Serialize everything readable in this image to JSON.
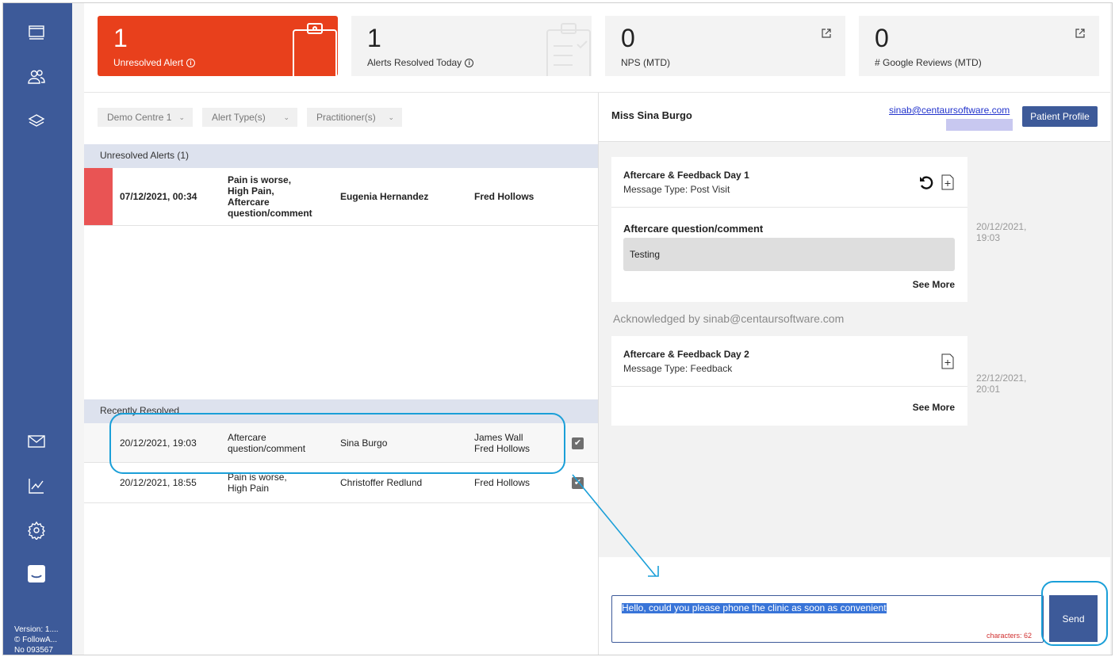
{
  "sidebar": {
    "nav_icons": [
      "dashboard-icon",
      "patients-icon",
      "layers-icon",
      "mail-icon",
      "chart-icon",
      "settings-icon",
      "inbox-icon"
    ],
    "version_lines": [
      "Version: 1....",
      "© FollowA...",
      "No 093567"
    ]
  },
  "stats": [
    {
      "value": "1",
      "label": "Unresolved Alert",
      "has_info": true,
      "color": "#e8401c"
    },
    {
      "value": "1",
      "label": "Alerts Resolved Today",
      "has_info": true
    },
    {
      "value": "0",
      "label": "NPS (MTD)",
      "has_link": true
    },
    {
      "value": "0",
      "label": "# Google Reviews (MTD)",
      "has_link": true
    }
  ],
  "filters": [
    {
      "label": "Demo Centre 1"
    },
    {
      "label": "Alert Type(s)"
    },
    {
      "label": "Practitioner(s)"
    }
  ],
  "unresolved": {
    "heading": "Unresolved Alerts (1)",
    "rows": [
      {
        "datetime": "07/12/2021, 00:34",
        "alert_lines": [
          "Pain is worse,",
          "High Pain,",
          "Aftercare",
          "question/comment"
        ],
        "patient": "Eugenia Hernandez",
        "practitioners": [
          "Fred Hollows"
        ]
      }
    ]
  },
  "resolved": {
    "heading": "Recently Resolved",
    "rows": [
      {
        "datetime": "20/12/2021, 19:03",
        "alert_lines": [
          "Aftercare",
          "question/comment"
        ],
        "patient": "Sina Burgo",
        "practitioners": [
          "James Wall",
          "Fred Hollows"
        ],
        "checked": true
      },
      {
        "datetime": "20/12/2021, 18:55",
        "alert_lines": [
          "Pain is worse,",
          "High Pain"
        ],
        "patient": "Christoffer Redlund",
        "practitioners": [
          "Fred Hollows"
        ],
        "checked": true
      }
    ]
  },
  "patient": {
    "name": "Miss Sina Burgo",
    "email": "sinab@centaursoftware.com",
    "profile_button": "Patient Profile"
  },
  "messages": [
    {
      "title": "Aftercare & Feedback Day 1",
      "type": "Message Type: Post Visit",
      "question": "Aftercare question/comment",
      "answer": "Testing",
      "see_more": "See More",
      "time_lines": [
        "20/12/2021,",
        "19:03"
      ]
    },
    {
      "title": "Aftercare & Feedback Day 2",
      "type": "Message Type: Feedback",
      "see_more": "See More",
      "time_lines": [
        "22/12/2021,",
        "20:01"
      ]
    }
  ],
  "acknowledged": "Acknowledged by sinab@centaursoftware.com",
  "reply": {
    "text": "Hello, could you please phone the clinic as soon as convenient",
    "char_count": "characters: 62",
    "send_label": "Send"
  },
  "colors": {
    "sidebar": "#3d5a99",
    "alert_red": "#e8401c",
    "annotation": "#1a9fd8"
  }
}
